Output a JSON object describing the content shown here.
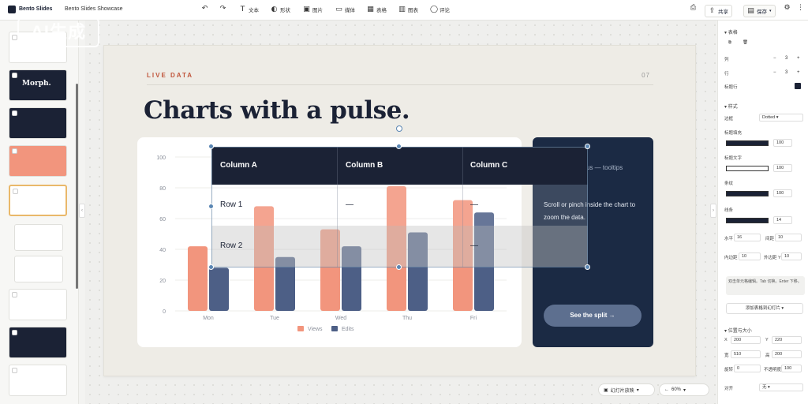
{
  "topbar": {
    "app_name": "Bento Slides",
    "doc_title": "Bento Slides Showcase",
    "tools": [
      {
        "icon": "undo-icon",
        "label": ""
      },
      {
        "icon": "redo-icon",
        "label": ""
      },
      {
        "icon": "text-icon",
        "label": "文本"
      },
      {
        "icon": "shape-icon",
        "label": "形状"
      },
      {
        "icon": "image-icon",
        "label": "图片"
      },
      {
        "icon": "media-icon",
        "label": "媒体"
      },
      {
        "icon": "table-icon",
        "label": "表格"
      },
      {
        "icon": "chart-icon",
        "label": "图表"
      },
      {
        "icon": "comment-icon",
        "label": "评论"
      }
    ],
    "share_label": "共享",
    "save_label": "保存"
  },
  "watermark": "AI生成",
  "slide": {
    "eyebrow": "LIVE DATA",
    "page_num": "07",
    "title": "Charts with a pulse.",
    "dark_card": {
      "heading": "us — tooltips",
      "body": "Scroll or pinch inside the chart to zoom the data.",
      "button": "See the split →"
    },
    "table": {
      "headers": [
        "Column A",
        "Column B",
        "Column C"
      ],
      "rows": [
        [
          "Row 1",
          "—",
          "—"
        ],
        [
          "Row 2",
          "",
          "—"
        ]
      ]
    }
  },
  "chart_data": {
    "type": "bar",
    "categories": [
      "Mon",
      "Tue",
      "Wed",
      "Thu",
      "Fri"
    ],
    "series": [
      {
        "name": "Views",
        "values": [
          42,
          68,
          53,
          81,
          72
        ],
        "color": "#f2957d"
      },
      {
        "name": "Edits",
        "values": [
          28,
          35,
          42,
          51,
          64
        ],
        "color": "#4d5f86"
      }
    ],
    "yticks": [
      "0",
      "20",
      "40",
      "60",
      "80",
      "100"
    ],
    "ylim": [
      0,
      100
    ],
    "grid": true,
    "legend": "bottom"
  },
  "bottom": {
    "slideshow_label": "幻灯片放映",
    "zoom_label": "60%"
  },
  "right_panel": {
    "section_table": "表格",
    "cols_label": "列",
    "cols_value": "3",
    "rows_label": "行",
    "rows_value": "3",
    "header_row_label": "标题行",
    "section_style": "样式",
    "border_label": "边框",
    "border_value": "Dotted",
    "fill_header_label": "标题填充",
    "fill_header_value": "100",
    "header_text_label": "标题文字",
    "header_text_value": "100",
    "stripe_label": "条纹",
    "stripe_value": "100",
    "line_label": "线条",
    "line_value": "14",
    "padding_h_label": "水平",
    "padding_h_value": "16",
    "gap_label": "间距",
    "gap_value": "10",
    "pad_y_label": "内边距 Y",
    "pad_y_value": "10",
    "pad_y2_label": "外边距 Y",
    "pad_y2_value": "10",
    "note": "双击单元格编辑。Tab 切换。Enter 下移。",
    "add_button": "添加表格到幻灯片",
    "section_position": "位置与大小",
    "x_label": "X",
    "x_value": "200",
    "y_label": "Y",
    "y_value": "220",
    "w_label": "宽",
    "w_value": "510",
    "h_label": "高",
    "h_value": "200",
    "rot_label": "旋转",
    "rot_value": "0",
    "opacity_label": "不透明度",
    "opacity_value": "100",
    "align_label": "对齐",
    "align_value": "无"
  }
}
